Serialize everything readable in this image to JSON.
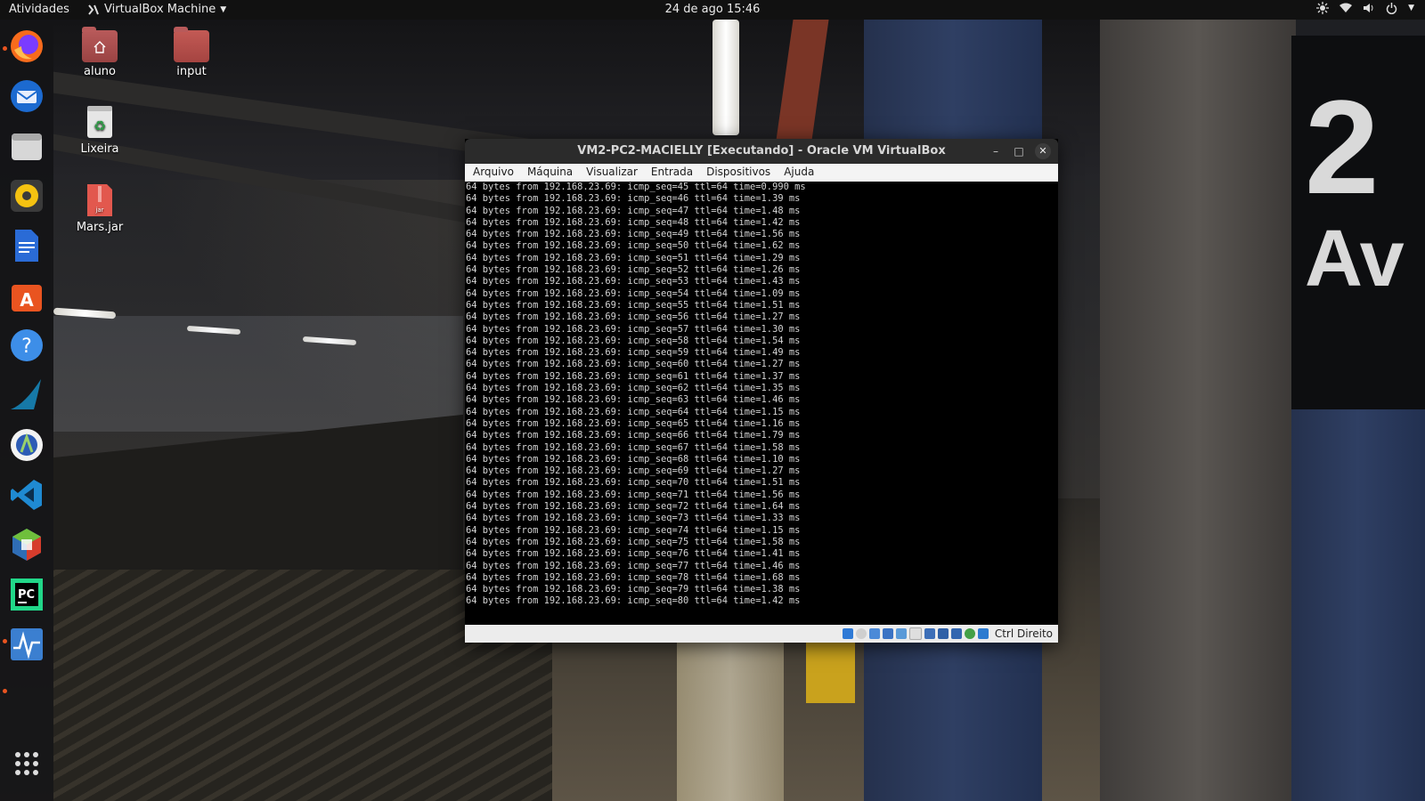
{
  "topbar": {
    "activities": "Atividades",
    "app_menu": "VirtualBox Machine",
    "clock": "24 de ago  15:46"
  },
  "desktop": {
    "icons": [
      {
        "label": "aluno",
        "icon": "home-folder-icon"
      },
      {
        "label": "input",
        "icon": "folder-icon"
      },
      {
        "label": "Lixeira",
        "icon": "trash-icon"
      },
      {
        "label": "Mars.jar",
        "icon": "jar-file-icon"
      }
    ]
  },
  "dock": {
    "apps": [
      "firefox-icon",
      "thunderbird-icon",
      "files-icon",
      "rhythmbox-icon",
      "writer-icon",
      "software-center-icon",
      "help-icon",
      "wireshark-icon",
      "android-studio-icon",
      "vscode-icon",
      "virtualbox-icon",
      "pycharm-icon",
      "system-monitor-icon",
      "show-applications-icon"
    ]
  },
  "vbox": {
    "title": "VM2-PC2-MACIELLY [Executando] - Oracle VM VirtualBox",
    "menu": [
      "Arquivo",
      "Máquina",
      "Visualizar",
      "Entrada",
      "Dispositivos",
      "Ajuda"
    ],
    "host_key": "Ctrl Direito",
    "terminal_lines": [
      "64 bytes from 192.168.23.69: icmp_seq=45 ttl=64 time=0.990 ms",
      "64 bytes from 192.168.23.69: icmp_seq=46 ttl=64 time=1.39 ms",
      "64 bytes from 192.168.23.69: icmp_seq=47 ttl=64 time=1.48 ms",
      "64 bytes from 192.168.23.69: icmp_seq=48 ttl=64 time=1.42 ms",
      "64 bytes from 192.168.23.69: icmp_seq=49 ttl=64 time=1.56 ms",
      "64 bytes from 192.168.23.69: icmp_seq=50 ttl=64 time=1.62 ms",
      "64 bytes from 192.168.23.69: icmp_seq=51 ttl=64 time=1.29 ms",
      "64 bytes from 192.168.23.69: icmp_seq=52 ttl=64 time=1.26 ms",
      "64 bytes from 192.168.23.69: icmp_seq=53 ttl=64 time=1.43 ms",
      "64 bytes from 192.168.23.69: icmp_seq=54 ttl=64 time=1.09 ms",
      "64 bytes from 192.168.23.69: icmp_seq=55 ttl=64 time=1.51 ms",
      "64 bytes from 192.168.23.69: icmp_seq=56 ttl=64 time=1.27 ms",
      "64 bytes from 192.168.23.69: icmp_seq=57 ttl=64 time=1.30 ms",
      "64 bytes from 192.168.23.69: icmp_seq=58 ttl=64 time=1.54 ms",
      "64 bytes from 192.168.23.69: icmp_seq=59 ttl=64 time=1.49 ms",
      "64 bytes from 192.168.23.69: icmp_seq=60 ttl=64 time=1.27 ms",
      "64 bytes from 192.168.23.69: icmp_seq=61 ttl=64 time=1.37 ms",
      "64 bytes from 192.168.23.69: icmp_seq=62 ttl=64 time=1.35 ms",
      "64 bytes from 192.168.23.69: icmp_seq=63 ttl=64 time=1.46 ms",
      "64 bytes from 192.168.23.69: icmp_seq=64 ttl=64 time=1.15 ms",
      "64 bytes from 192.168.23.69: icmp_seq=65 ttl=64 time=1.16 ms",
      "64 bytes from 192.168.23.69: icmp_seq=66 ttl=64 time=1.79 ms",
      "64 bytes from 192.168.23.69: icmp_seq=67 ttl=64 time=1.58 ms",
      "64 bytes from 192.168.23.69: icmp_seq=68 ttl=64 time=1.10 ms",
      "64 bytes from 192.168.23.69: icmp_seq=69 ttl=64 time=1.27 ms",
      "64 bytes from 192.168.23.69: icmp_seq=70 ttl=64 time=1.51 ms",
      "64 bytes from 192.168.23.69: icmp_seq=71 ttl=64 time=1.56 ms",
      "64 bytes from 192.168.23.69: icmp_seq=72 ttl=64 time=1.64 ms",
      "64 bytes from 192.168.23.69: icmp_seq=73 ttl=64 time=1.33 ms",
      "64 bytes from 192.168.23.69: icmp_seq=74 ttl=64 time=1.15 ms",
      "64 bytes from 192.168.23.69: icmp_seq=75 ttl=64 time=1.58 ms",
      "64 bytes from 192.168.23.69: icmp_seq=76 ttl=64 time=1.41 ms",
      "64 bytes from 192.168.23.69: icmp_seq=77 ttl=64 time=1.46 ms",
      "64 bytes from 192.168.23.69: icmp_seq=78 ttl=64 time=1.68 ms",
      "64 bytes from 192.168.23.69: icmp_seq=79 ttl=64 time=1.38 ms",
      "64 bytes from 192.168.23.69: icmp_seq=80 ttl=64 time=1.42 ms"
    ]
  },
  "wallpaper": {
    "sign_text_line1": "2",
    "sign_text_line2": "Av"
  }
}
